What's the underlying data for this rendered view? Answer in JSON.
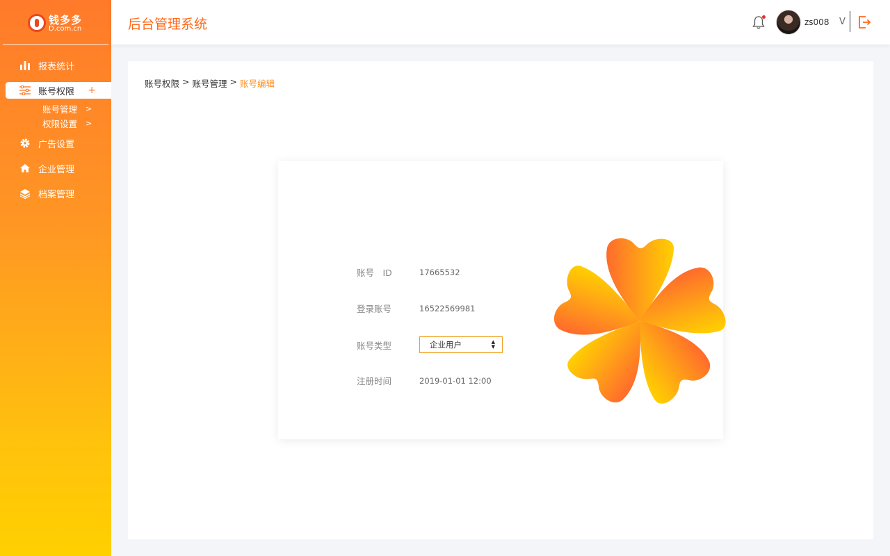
{
  "brand": {
    "name": "钱多多",
    "domain": "D.com.cn",
    "accent": "#ff6a1a",
    "gradient_top": "#ff7a2a",
    "gradient_bottom": "#ffd000"
  },
  "header": {
    "title": "后台管理系统",
    "username": "zs008",
    "chevron": "V"
  },
  "sidebar": {
    "items": [
      {
        "label": "报表统计",
        "icon": "bar-chart-icon"
      },
      {
        "label": "账号权限",
        "icon": "sliders-icon",
        "active": true,
        "toggle": "+"
      },
      {
        "label": "广告设置",
        "icon": "gear-icon"
      },
      {
        "label": "企业管理",
        "icon": "home-icon"
      },
      {
        "label": "档案管理",
        "icon": "layers-icon"
      }
    ],
    "subitems": [
      {
        "label": "账号管理",
        "arrow": ">"
      },
      {
        "label": "权限设置",
        "arrow": ">"
      }
    ]
  },
  "breadcrumb": {
    "items": [
      "账号权限",
      "账号管理"
    ],
    "separator": ">",
    "current": "账号编辑"
  },
  "form": {
    "account_id": {
      "label": "账号　ID",
      "value": "17665532"
    },
    "login_account": {
      "label": "登录账号",
      "value": "16522569981"
    },
    "account_type": {
      "label": "账号类型",
      "value": "企业用户"
    },
    "register_time": {
      "label": "注册时间",
      "value": "2019-01-01 12:00"
    }
  }
}
